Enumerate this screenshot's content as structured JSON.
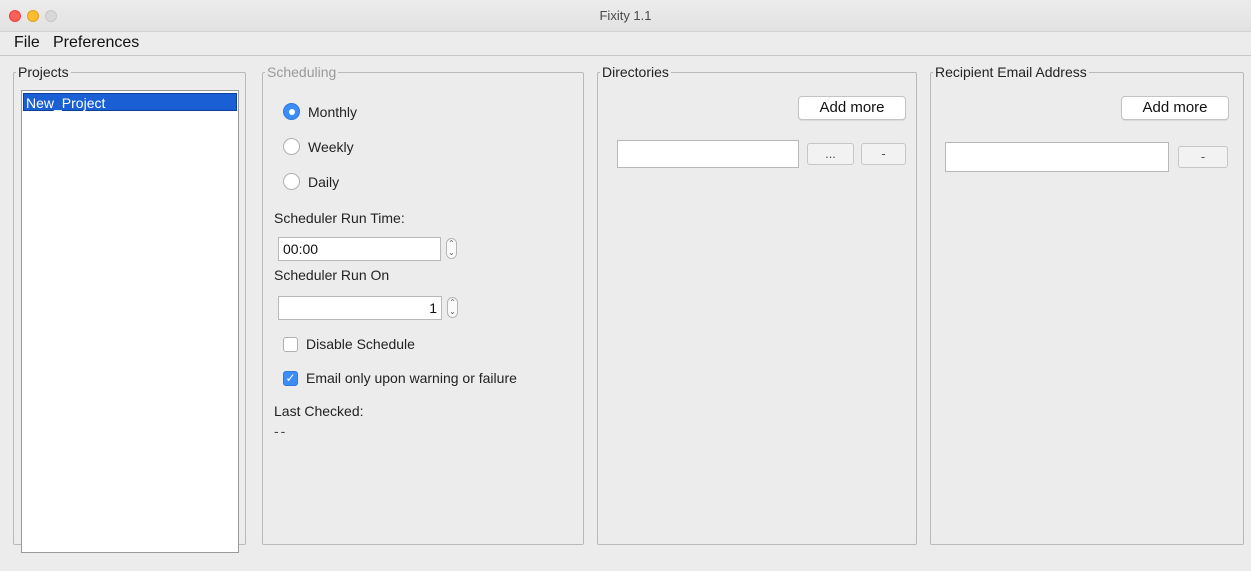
{
  "window": {
    "title": "Fixity 1.1"
  },
  "menu": {
    "file": "File",
    "preferences": "Preferences"
  },
  "projects": {
    "legend": "Projects",
    "items": [
      "New_Project"
    ]
  },
  "scheduling": {
    "legend": "Scheduling",
    "frequency_options": [
      "Monthly",
      "Weekly",
      "Daily"
    ],
    "selected_frequency": "Monthly",
    "run_time_label": "Scheduler Run Time:",
    "run_time_value": "00:00",
    "run_on_label": "Scheduler Run On",
    "run_on_value": "1",
    "disable_schedule_label": "Disable Schedule",
    "disable_schedule_checked": false,
    "email_only_label": "Email only upon warning or failure",
    "email_only_checked": true,
    "last_checked_label": "Last Checked:",
    "last_checked_value": "--"
  },
  "directories": {
    "legend": "Directories",
    "add_more_label": "Add more",
    "path_value": "",
    "browse_label": "...",
    "remove_label": "-"
  },
  "recipients": {
    "legend": "Recipient Email Address",
    "add_more_label": "Add more",
    "email_value": "",
    "remove_label": "-"
  },
  "colors": {
    "selection": "#1a5fd3",
    "accent": "#3c8df7",
    "close": "#fe5f57",
    "minimize": "#febc2e"
  }
}
